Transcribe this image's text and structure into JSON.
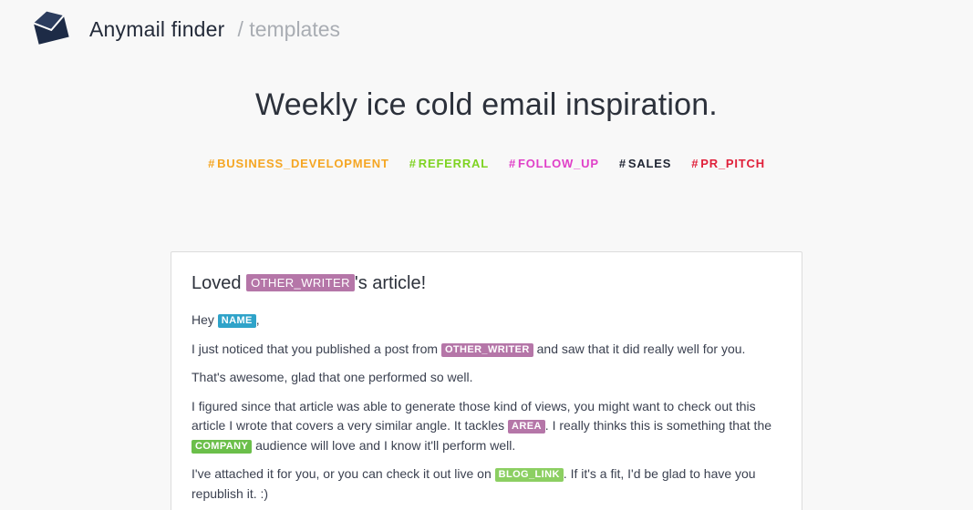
{
  "header": {
    "brand": "Anymail finder",
    "breadcrumb": "/ templates"
  },
  "hero": {
    "title": "Weekly ice cold email inspiration."
  },
  "tags": [
    {
      "hash": "#",
      "label": "BUSINESS_DEVELOPMENT",
      "color": "#f5a623"
    },
    {
      "hash": "#",
      "label": "REFERRAL",
      "color": "#7ed321"
    },
    {
      "hash": "#",
      "label": "FOLLOW_UP",
      "color": "#e040c8"
    },
    {
      "hash": "#",
      "label": "SALES",
      "color": "#1f2533"
    },
    {
      "hash": "#",
      "label": "PR_PITCH",
      "color": "#e0203a"
    }
  ],
  "colors": {
    "other_writer": "#b576a8",
    "name": "#2fa3c9",
    "area": "#b576a8",
    "company": "#6bbf4a",
    "blog_link": "#8ccf62",
    "logo": "#1d2b46"
  },
  "card": {
    "title_before": "Loved",
    "title_var": "OTHER_WRITER",
    "title_after": "'s article!",
    "greeting_before": "Hey",
    "greeting_var": "NAME",
    "greeting_after": ",",
    "p1_before": "I just noticed that you published a post from",
    "p1_var": "OTHER_WRITER",
    "p1_after": "and saw that it did really well for you.",
    "p2": "That's awesome, glad that one performed so well.",
    "p3_before": "I figured since that article was able to generate those kind of views, you might want to check out this article I wrote that covers a very similar angle. It tackles",
    "p3_var1": "AREA",
    "p3_mid": ". I really thinks this is something that the",
    "p3_var2": "COMPANY",
    "p3_after": "audience will love and I know it'll perform well.",
    "p4_before": "I've attached it for you, or you can check it out live on",
    "p4_var": "BLOG_LINK",
    "p4_after": ". If it's a fit, I'd be glad to have you republish it. :)"
  }
}
